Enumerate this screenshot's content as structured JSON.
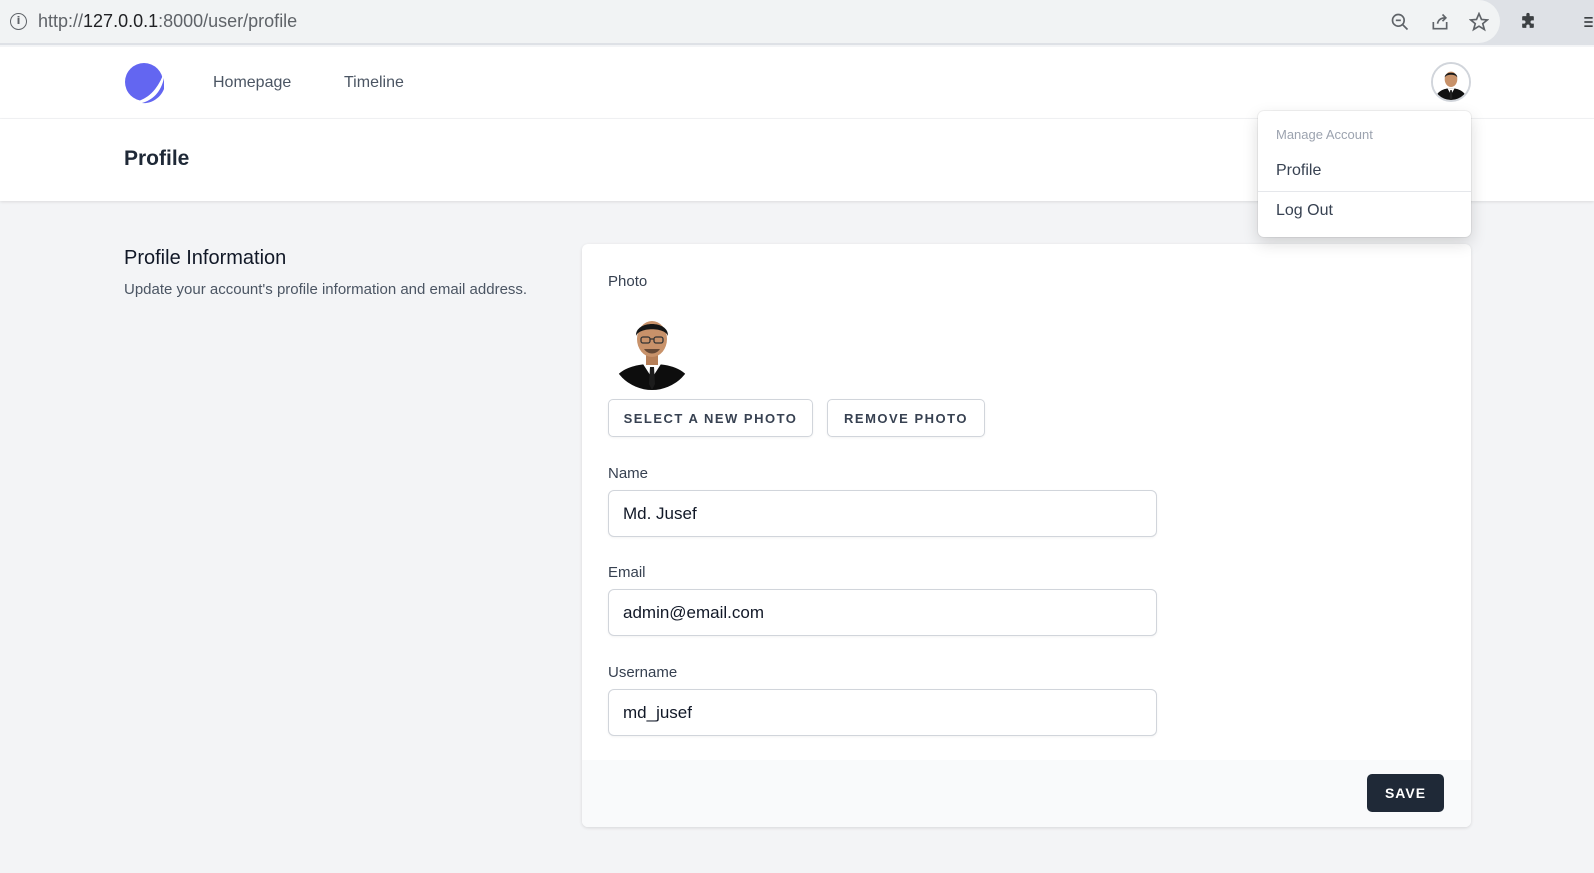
{
  "browser": {
    "url_scheme": "http://",
    "url_host": "127.0.0.1",
    "url_rest": ":8000/user/profile",
    "icons": [
      "info-icon",
      "zoom-out-icon",
      "share-icon",
      "bookmark-star-icon",
      "extensions-icon",
      "menu-icon"
    ]
  },
  "nav": {
    "logo_icon": "app-logo-icon",
    "links": [
      "Homepage",
      "Timeline"
    ],
    "avatar_icon": "user-avatar"
  },
  "page": {
    "title": "Profile"
  },
  "section": {
    "title": "Profile Information",
    "description": "Update your account's profile information and email address."
  },
  "form": {
    "photo_label": "Photo",
    "select_photo_button": "Select A New Photo",
    "remove_photo_button": "Remove Photo",
    "name_label": "Name",
    "name_value": "Md. Jusef",
    "email_label": "Email",
    "email_value": "admin@email.com",
    "username_label": "Username",
    "username_value": "md_jusef",
    "save_button": "Save"
  },
  "dropdown": {
    "heading": "Manage Account",
    "items": [
      "Profile",
      "Log Out"
    ]
  },
  "colors": {
    "brand": "#6366f1",
    "page_bg": "#f3f4f6",
    "primary_button": "#1f2937"
  }
}
